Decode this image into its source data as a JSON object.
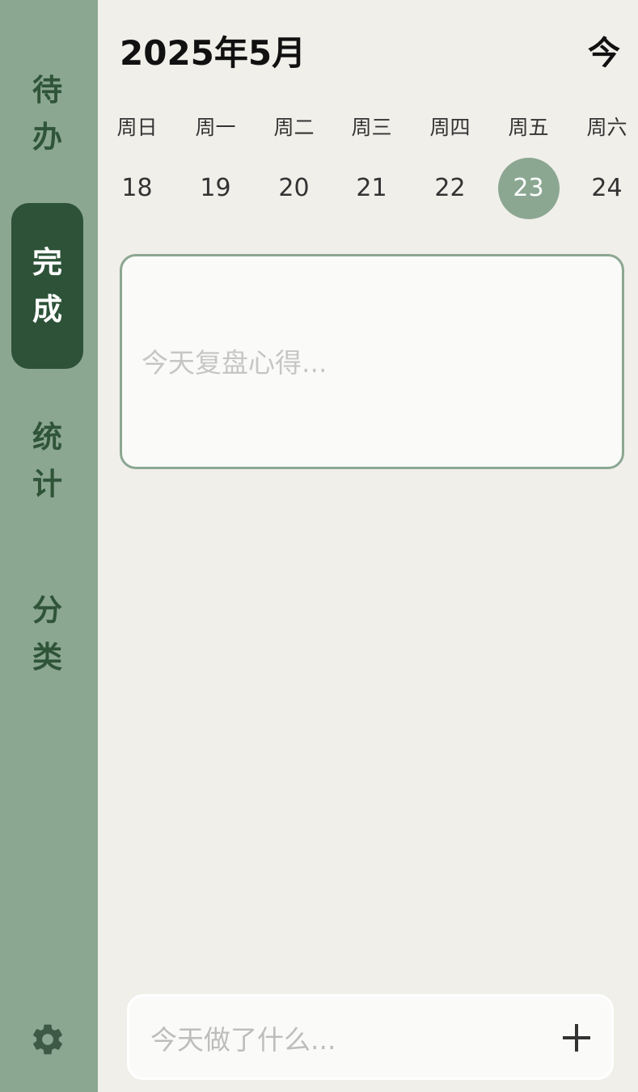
{
  "sidebar": {
    "items": [
      {
        "chars": [
          "待",
          "办"
        ],
        "active": false
      },
      {
        "chars": [
          "完",
          "成"
        ],
        "active": true
      },
      {
        "chars": [
          "统",
          "计"
        ],
        "active": false
      },
      {
        "chars": [
          "分",
          "类"
        ],
        "active": false
      }
    ],
    "settings_icon": "gear-icon"
  },
  "header": {
    "month_title": "2025年5月",
    "today_label": "今"
  },
  "week": {
    "weekdays": [
      "周日",
      "周一",
      "周二",
      "周三",
      "周四",
      "周五",
      "周六"
    ],
    "dates": [
      "18",
      "19",
      "20",
      "21",
      "22",
      "23",
      "24"
    ],
    "selected_index": 5
  },
  "review": {
    "placeholder": "今天复盘心得..."
  },
  "add_bar": {
    "placeholder": "今天做了什么...",
    "add_icon": "plus-icon"
  },
  "colors": {
    "sidebar": "#8ba792",
    "active_nav": "#2d5238",
    "nav_text": "#2f5438",
    "background": "#f0efea",
    "selected_date": "#8ba792"
  }
}
